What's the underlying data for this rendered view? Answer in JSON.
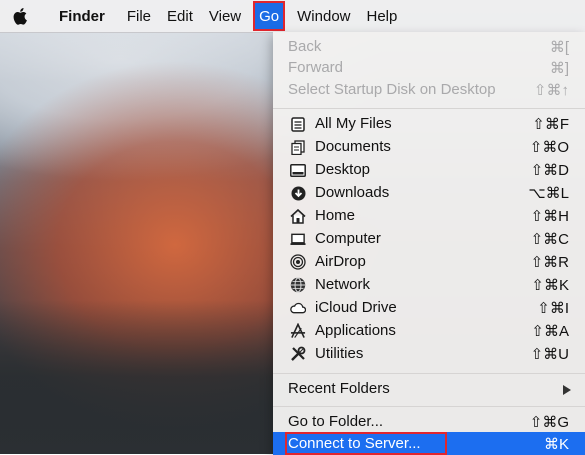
{
  "menubar": {
    "app_name": "Finder",
    "menus": [
      "File",
      "Edit",
      "View",
      "Go",
      "Window",
      "Help"
    ],
    "active_menu": "Go"
  },
  "go_menu": {
    "items_disabled": [
      {
        "label": "Back",
        "shortcut": "⌘["
      },
      {
        "label": "Forward",
        "shortcut": "⌘]"
      },
      {
        "label": "Select Startup Disk on Desktop",
        "shortcut": "⇧⌘↑"
      }
    ],
    "locations": [
      {
        "label": "All My Files",
        "shortcut": "⇧⌘F",
        "icon": "all-my-files-icon"
      },
      {
        "label": "Documents",
        "shortcut": "⇧⌘O",
        "icon": "documents-icon"
      },
      {
        "label": "Desktop",
        "shortcut": "⇧⌘D",
        "icon": "desktop-icon"
      },
      {
        "label": "Downloads",
        "shortcut": "⌥⌘L",
        "icon": "downloads-icon"
      },
      {
        "label": "Home",
        "shortcut": "⇧⌘H",
        "icon": "home-icon"
      },
      {
        "label": "Computer",
        "shortcut": "⇧⌘C",
        "icon": "computer-icon"
      },
      {
        "label": "AirDrop",
        "shortcut": "⇧⌘R",
        "icon": "airdrop-icon"
      },
      {
        "label": "Network",
        "shortcut": "⇧⌘K",
        "icon": "network-icon"
      },
      {
        "label": "iCloud Drive",
        "shortcut": "⇧⌘I",
        "icon": "icloud-icon"
      },
      {
        "label": "Applications",
        "shortcut": "⇧⌘A",
        "icon": "applications-icon"
      },
      {
        "label": "Utilities",
        "shortcut": "⇧⌘U",
        "icon": "utilities-icon"
      }
    ],
    "recent_folders": {
      "label": "Recent Folders"
    },
    "go_to_folder": {
      "label": "Go to Folder...",
      "shortcut": "⇧⌘G"
    },
    "connect_to_server": {
      "label": "Connect to Server...",
      "shortcut": "⌘K"
    }
  },
  "colors": {
    "accent": "#1c6ef0",
    "callout_outline": "#e0262e"
  }
}
